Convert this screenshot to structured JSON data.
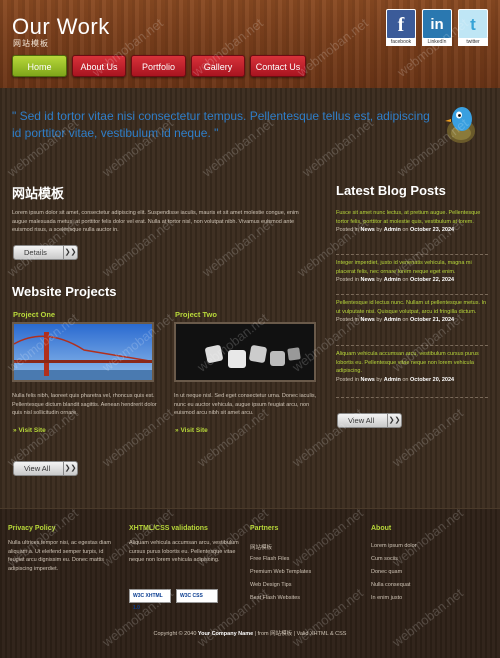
{
  "header": {
    "title": "Our Work",
    "subtitle": "网站模板",
    "social": [
      {
        "name": "facebook",
        "glyph": "f",
        "caption": "facebook"
      },
      {
        "name": "linkedin",
        "glyph": "in",
        "caption": "LinkedIn"
      },
      {
        "name": "twitter",
        "glyph": "t",
        "caption": "twitter"
      }
    ]
  },
  "nav": [
    "Home",
    "About Us",
    "Portfolio",
    "Gallery",
    "Contact Us"
  ],
  "quote": "\" Sed id tortor vitae nisi consectetur tempus. Pellentesque tellus est, adipiscing id porttitor vitae, vestibulum id neque. \"",
  "intro": {
    "heading": "网站模板",
    "text": "Lorem ipsum dolor sit amet, consectetur adipiscing elit. Suspendisse iaculis, mauris et sit amet molestie congue, enim augue malesuada metus, at porttitor felis dolor vel erat. Nulla at tortor nisl, non volutpat nibh. Vivamus euismod ante euismod risus, a scelerisque nulla auctor in.",
    "button": "Details"
  },
  "projects": {
    "heading": "Website Projects",
    "items": [
      {
        "title": "Project One",
        "text": "Nulla felis nibh, laoreet quis pharetra vel, rhoncus quis est. Pellentesque dictum blandit sagittis. Aenean hendrerit dolor quis nisl sollicitudin ornare.",
        "link": "Visit Site"
      },
      {
        "title": "Project Two",
        "text": "In ut neque nisl. Sed eget consectetur urna. Donec iaculis, nunc eu auctor vehicula, augue ipsum feugiat arcu, non euismod arcu nibh sit amet arcu.",
        "link": "Visit Site"
      }
    ],
    "button": "View All"
  },
  "blog": {
    "heading": "Latest Blog Posts",
    "posts": [
      {
        "text": "Fusce sit amet nunc lectus, at pretium augue. Pellentesque tortor felis, porttitor at molestie quis, vestibulum at lorem.",
        "category": "News",
        "author": "Admin",
        "date": "October 23, 2024"
      },
      {
        "text": "Integer imperdiet, justo id venenatis vehicula, magna mi placerat felis, nec ornare lorem neque eget enim.",
        "category": "News",
        "author": "Admin",
        "date": "October 22, 2024"
      },
      {
        "text": "Pellentesque id lectus nunc. Nullam ut pellentesque metus. In ut vulputate nisi. Quisque volutpat, arcu id fringilla dictum.",
        "category": "News",
        "author": "Admin",
        "date": "October 21, 2024"
      },
      {
        "text": "Aliquam vehicula accumsan arcu, vestibulum cursus purus lobortis eu. Pellentesque vitae neque non lorem vehicula adipiscing.",
        "category": "News",
        "author": "Admin",
        "date": "October 20, 2024"
      }
    ],
    "posted_in": "Posted in",
    "by": "by",
    "on": "on",
    "button": "View All"
  },
  "footer": {
    "privacy": {
      "title": "Privacy Policy",
      "text": "Nulla ultrices tempor nisi, ac egestas diam aliquam a. Ut eleifend semper turpis, id feugiat arcu dignissim eu. Donec mattis adipiscing imperdiet."
    },
    "validations": {
      "title": "XHTML/CSS validations",
      "text": "Aliquam vehicula accumsan arcu, vestibulum cursus purus lobortis eu. Pellentesque vitae neque non lorem vehicula adipiscing.",
      "badge1": "W3C XHTML 1.0",
      "badge2": "W3C CSS"
    },
    "partners": {
      "title": "Partners",
      "links": [
        "网站模板",
        "Free Flash Files",
        "Premium Web Templates",
        "Web Design Tips",
        "Best Flash Websites"
      ]
    },
    "about": {
      "title": "About",
      "links": [
        "Lorem ipsum dolor",
        "Cum sociis",
        "Donec quam",
        "Nulla consequat",
        "In enim justo"
      ]
    },
    "copyright_prefix": "Copyright © 2040",
    "company": "Your Company Name",
    "copyright_mid": "| from 网站模板 | Valid",
    "copyright_suffix": "XHTML & CSS"
  },
  "watermark": "webmoban.net",
  "colors": {
    "accent_green": "#b8d83a",
    "nav_red": "#c8202c",
    "quote_blue": "#2f7ec8"
  }
}
